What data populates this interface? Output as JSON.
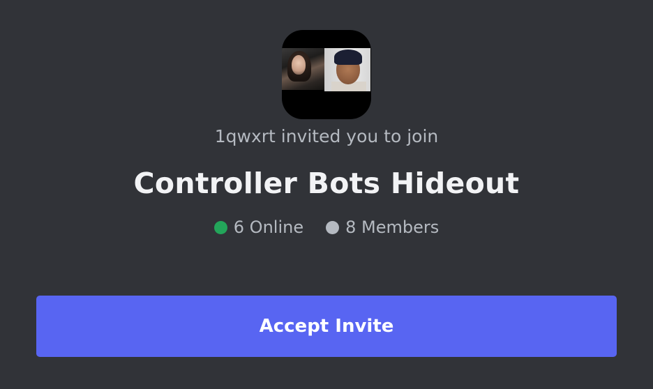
{
  "invite": {
    "inviter_text": "1qwxrt invited you to join",
    "server_name": "Controller Bots Hideout",
    "online": {
      "label": "6 Online",
      "color": "#23a55a"
    },
    "members": {
      "label": "8 Members",
      "color": "#b5bac1"
    },
    "accept_label": "Accept Invite",
    "accent_color": "#5865f2"
  }
}
